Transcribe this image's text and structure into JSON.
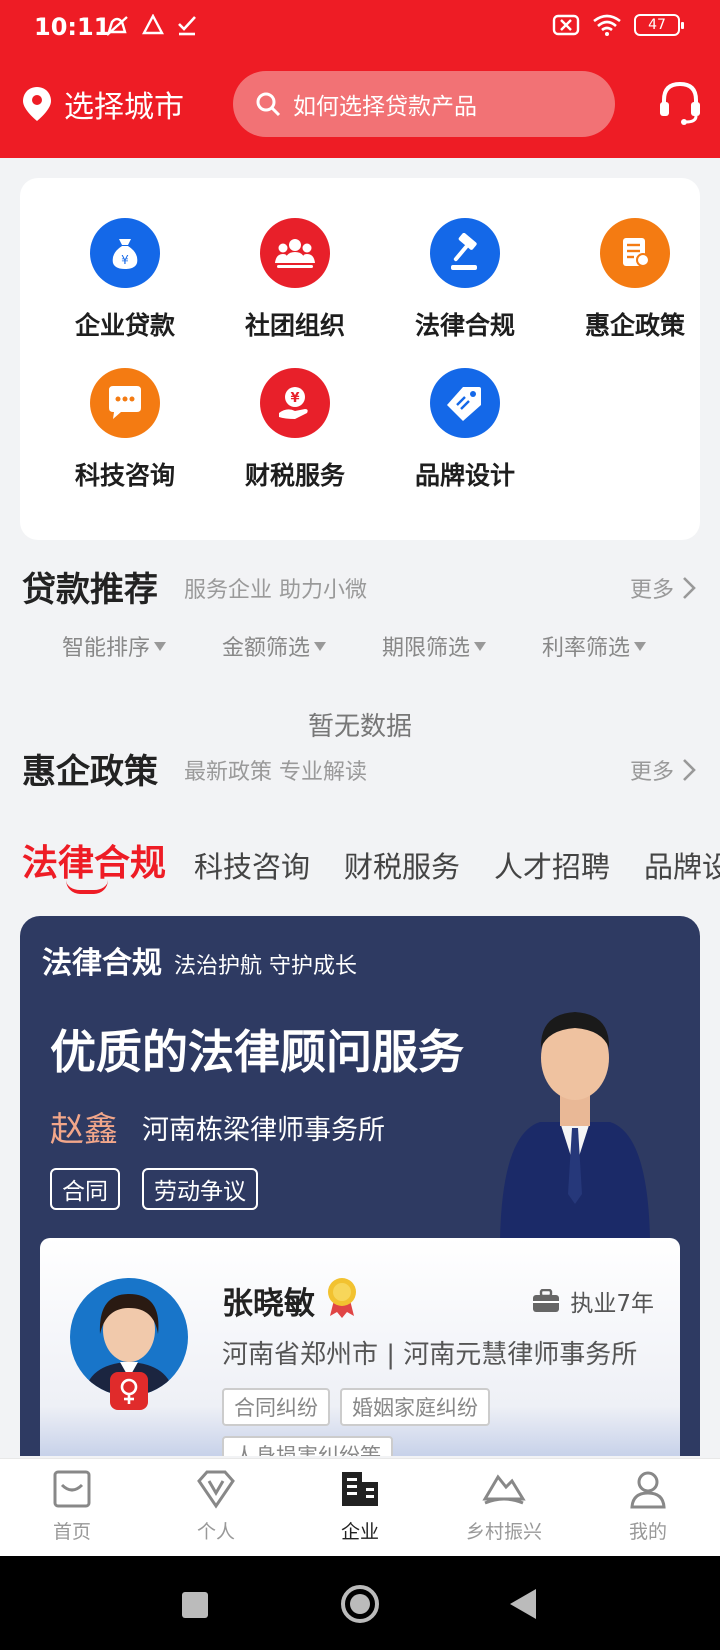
{
  "status": {
    "time": "10:11",
    "battery": "47"
  },
  "header": {
    "city_label": "选择城市",
    "search_placeholder": "如何选择贷款产品"
  },
  "services": [
    {
      "label": "企业贷款",
      "color": "#1468e8",
      "icon": "money-bag-icon"
    },
    {
      "label": "社团组织",
      "color": "#e8202a",
      "icon": "group-icon"
    },
    {
      "label": "法律合规",
      "color": "#1468e8",
      "icon": "gavel-icon"
    },
    {
      "label": "惠企政策",
      "color": "#f47b12",
      "icon": "policy-document-icon"
    },
    {
      "label": "科技咨询",
      "color": "#f47b12",
      "icon": "chat-bubble-icon"
    },
    {
      "label": "财税服务",
      "color": "#e8202a",
      "icon": "yen-hand-icon"
    },
    {
      "label": "品牌设计",
      "color": "#1468e8",
      "icon": "brand-tag-icon"
    }
  ],
  "loan_section": {
    "title": "贷款推荐",
    "subtitle": "服务企业 助力小微",
    "more": "更多"
  },
  "filters": [
    "智能排序",
    "金额筛选",
    "期限筛选",
    "利率筛选"
  ],
  "empty_text": "暂无数据",
  "policy_section": {
    "title": "惠企政策",
    "subtitle": "最新政策 专业解读",
    "more": "更多"
  },
  "tabs": [
    "法律合规",
    "科技咨询",
    "财税服务",
    "人才招聘",
    "品牌设计"
  ],
  "banner": {
    "title": "法律合规",
    "tagline": "法治护航  守护成长",
    "slogan": "优质的法律顾问服务",
    "lawyer_name": "赵鑫",
    "firm": "河南栋梁律师事务所",
    "tags": [
      "合同",
      "劳动争议"
    ]
  },
  "lawyer_card": {
    "name": "张晓敏",
    "years": "执业7年",
    "location": "河南省郑州市 | 河南元慧律师事务所",
    "tags": [
      "合同纠纷",
      "婚姻家庭纠纷",
      "人身损害纠纷等"
    ]
  },
  "bottom_nav": [
    {
      "label": "首页",
      "icon": "home-icon"
    },
    {
      "label": "个人",
      "icon": "diamond-v-icon"
    },
    {
      "label": "企业",
      "icon": "building-icon",
      "active": true
    },
    {
      "label": "乡村振兴",
      "icon": "mountain-icon"
    },
    {
      "label": "我的",
      "icon": "user-icon"
    }
  ],
  "colors": {
    "brand_red": "#ee1c25",
    "banner_navy": "#2e3a62"
  }
}
